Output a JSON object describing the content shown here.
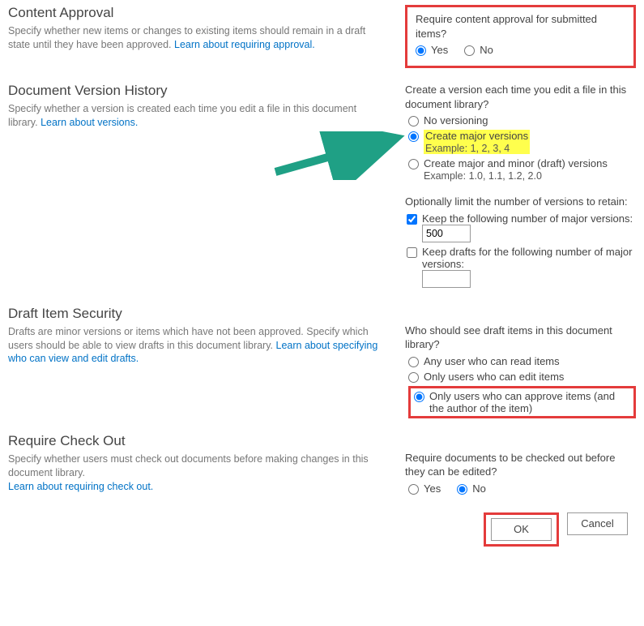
{
  "contentApproval": {
    "title": "Content Approval",
    "desc": "Specify whether new items or changes to existing items should remain in a draft state until they have been approved.",
    "learnLink": "Learn about requiring approval.",
    "question": "Require content approval for submitted items?",
    "yes": "Yes",
    "no": "No"
  },
  "versionHistory": {
    "title": "Document Version History",
    "desc": "Specify whether a version is created each time you edit a file in this document library.",
    "learnLink": "Learn about versions.",
    "q1": "Create a version each time you edit a file in this document library?",
    "optNone": "No versioning",
    "optMajor": "Create major versions",
    "exMajor": "Example: 1, 2, 3, 4",
    "optMinor": "Create major and minor (draft) versions",
    "exMinor": "Example: 1.0, 1.1, 1.2, 2.0",
    "q2": "Optionally limit the number of versions to retain:",
    "keepMajor": "Keep the following number of major versions:",
    "keepMajorVal": "500",
    "keepDrafts": "Keep drafts for the following number of major versions:"
  },
  "draftSecurity": {
    "title": "Draft Item Security",
    "desc": "Drafts are minor versions or items which have not been approved. Specify which users should be able to view drafts in this document library.",
    "learnLink": "Learn about specifying who can view and edit drafts.",
    "q": "Who should see draft items in this document library?",
    "optRead": "Any user who can read items",
    "optEdit": "Only users who can edit items",
    "optApprove": "Only users who can approve items (and the author of the item)"
  },
  "checkOut": {
    "title": "Require Check Out",
    "desc": "Specify whether users must check out documents before making changes in this document library.",
    "learnLink": "Learn about requiring check out.",
    "q": "Require documents to be checked out before they can be edited?",
    "yes": "Yes",
    "no": "No"
  },
  "footer": {
    "ok": "OK",
    "cancel": "Cancel"
  }
}
